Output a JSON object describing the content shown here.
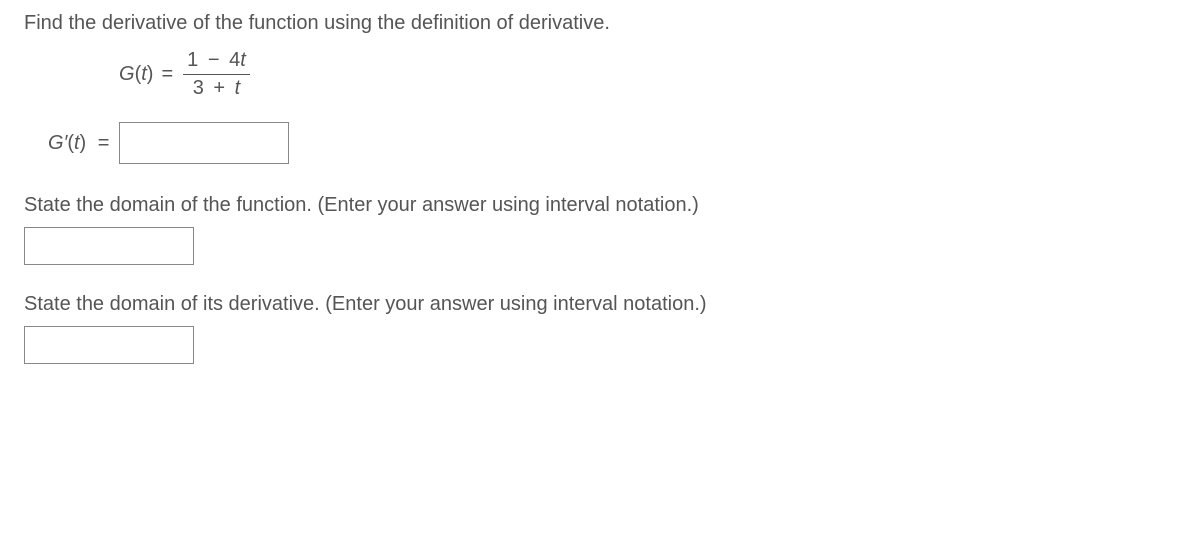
{
  "prompt": "Find the derivative of the function using the definition of derivative.",
  "formula": {
    "label_func": "G",
    "label_arg": "t",
    "num_part1": "1",
    "num_minus": "−",
    "num_part2": "4",
    "num_var": "t",
    "den_part1": "3",
    "den_plus": "+",
    "den_var": "t"
  },
  "derivative": {
    "label_func": "G",
    "label_prime": "′",
    "label_arg": "t",
    "equals": "="
  },
  "domain_function": {
    "text": "State the domain of the function. (Enter your answer using interval notation.)"
  },
  "domain_derivative": {
    "text": "State the domain of its derivative. (Enter your answer using interval notation.)"
  },
  "equals": "="
}
